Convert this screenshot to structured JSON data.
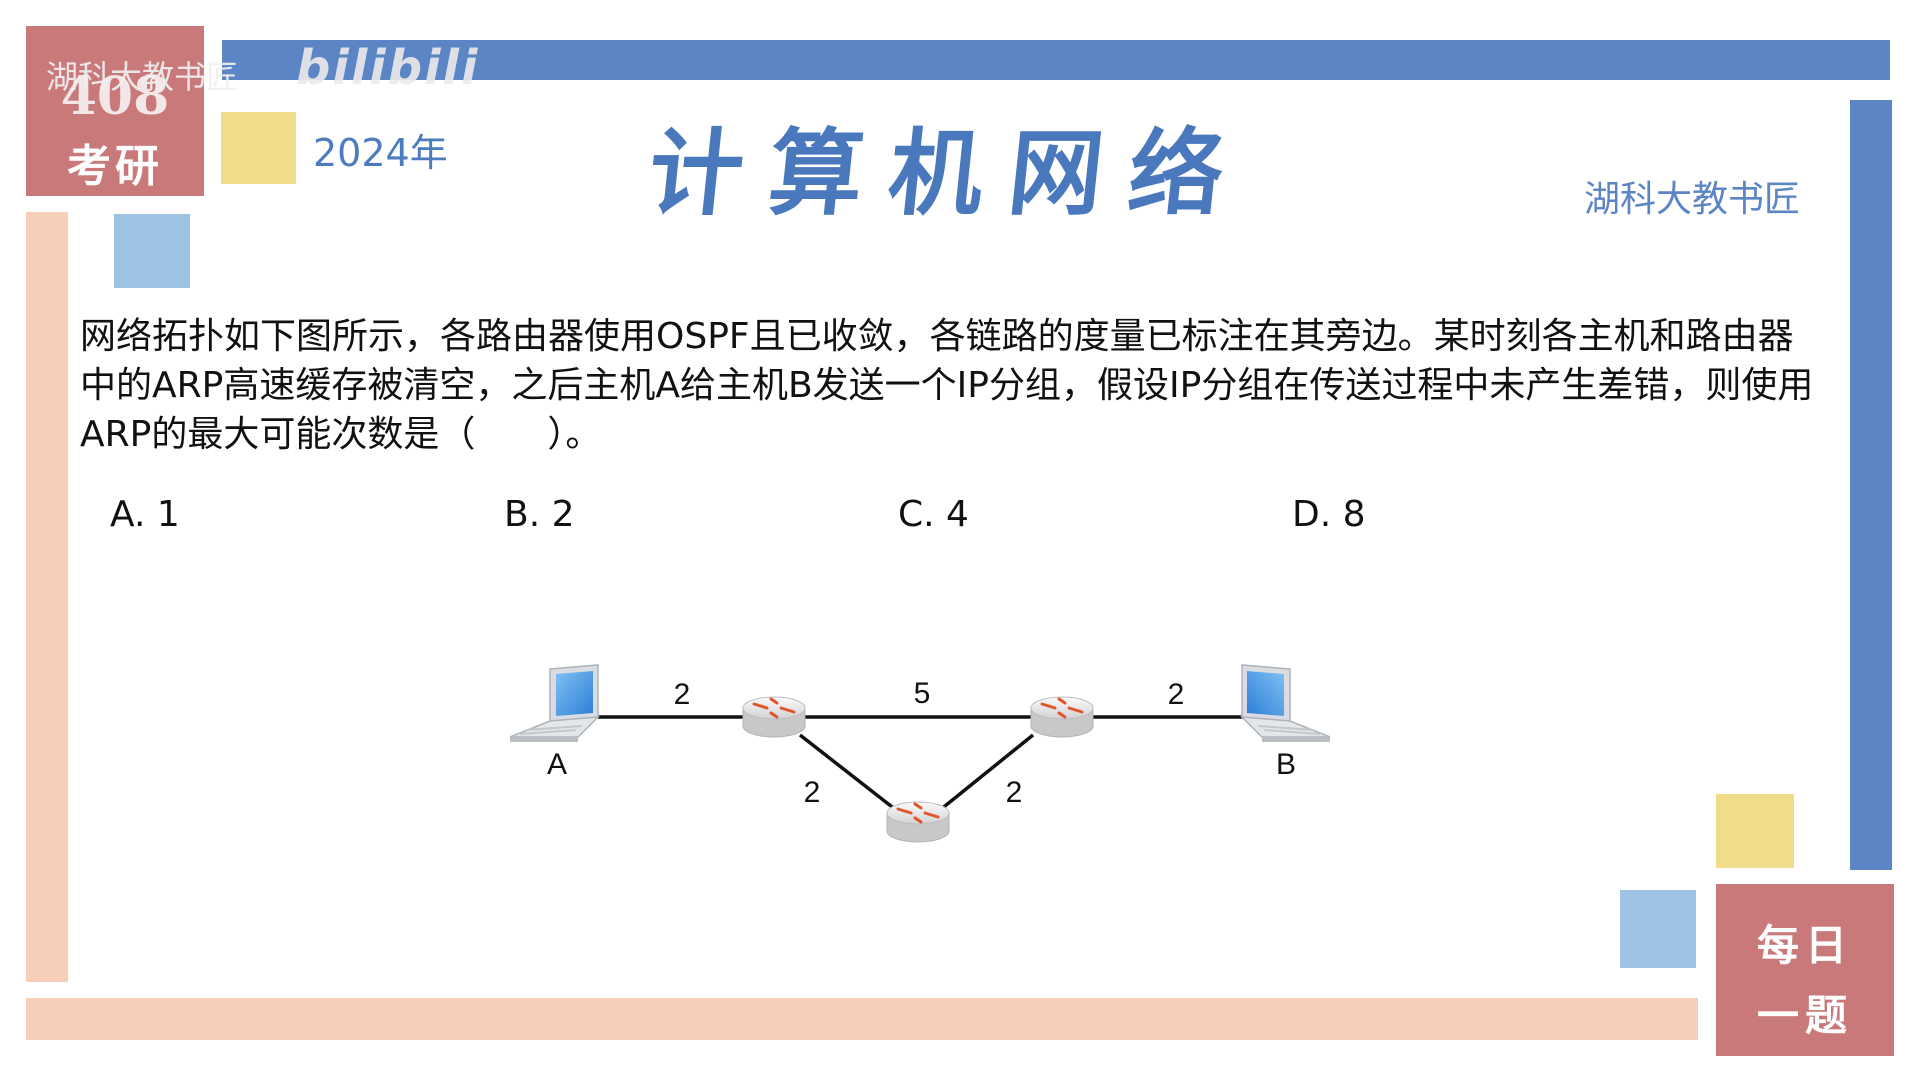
{
  "watermark": "湖科大教书匠",
  "bilibili_logo": "bilibili",
  "badge_top": {
    "number": "408",
    "word": "考研"
  },
  "year": "2024年",
  "title": "计算机网络",
  "author": "湖科大教书匠",
  "badge_bottom": {
    "line1": "每日",
    "line2": "一题"
  },
  "question": "网络拓扑如下图所示，各路由器使用OSPF且已收敛，各链路的度量已标注在其旁边。某时刻各主机和路由器中的ARP高速缓存被清空，之后主机A给主机B发送一个IP分组，假设IP分组在传送过程中未产生差错，则使用ARP的最大可能次数是（　　）。",
  "options": [
    "A. 1",
    "B. 2",
    "C. 4",
    "D. 8"
  ],
  "topology": {
    "hosts": [
      "A",
      "B"
    ],
    "link_metrics": {
      "a_r1": "2",
      "r1_r2": "5",
      "r2_b": "2",
      "r1_r3": "2",
      "r3_r2": "2"
    }
  },
  "colors": {
    "accent_blue": "#5b85c4",
    "badge_red": "#c9797a",
    "peach": "#f7cfb8",
    "yellow": "#f0dc8a",
    "light_blue": "#9fc3e4",
    "router_icon": "#e0562f"
  }
}
